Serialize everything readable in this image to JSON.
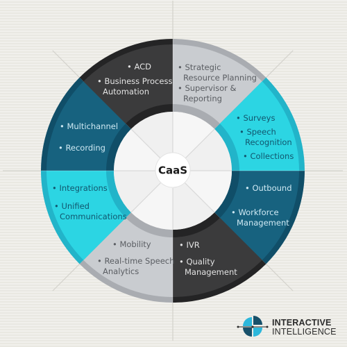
{
  "diagram": {
    "center_label": "CaaS",
    "colors": {
      "light_gray": "#c9ccd0",
      "light_gray_edge": "#a9acb1",
      "cyan": "#2cd5e3",
      "cyan_edge": "#22b4c9",
      "teal": "#17627f",
      "teal_edge": "#104e68",
      "charcoal": "#3b3b3c",
      "charcoal_edge": "#242425",
      "hub": "#f6f6f6"
    },
    "segments": [
      {
        "id": "strategic",
        "color": "light_gray",
        "text_color": "#5a5d62",
        "items": [
          "Strategic Resource Planning",
          "Supervisor & Reporting"
        ]
      },
      {
        "id": "surveys",
        "color": "cyan",
        "text_color": "#11566e",
        "items": [
          "Surveys",
          "Speech Recognition",
          "Collections"
        ]
      },
      {
        "id": "outbound",
        "color": "teal",
        "text_color": "#cfe9f3",
        "items": [
          "Outbound",
          "Workforce Management"
        ]
      },
      {
        "id": "ivr",
        "color": "charcoal",
        "text_color": "#e4e4e4",
        "items": [
          "IVR",
          "Quality Management"
        ]
      },
      {
        "id": "mobility",
        "color": "light_gray",
        "text_color": "#5a5d62",
        "items": [
          "Mobility",
          "Real-time Speech Analytics"
        ]
      },
      {
        "id": "integrations",
        "color": "cyan",
        "text_color": "#11566e",
        "items": [
          "Integrations",
          "Unified Communications"
        ]
      },
      {
        "id": "multichannel",
        "color": "teal",
        "text_color": "#cfe9f3",
        "items": [
          "Multichannel",
          "Recording"
        ]
      },
      {
        "id": "acd",
        "color": "charcoal",
        "text_color": "#e4e4e4",
        "items": [
          "ACD",
          "Business Process Automation"
        ]
      }
    ]
  },
  "logo": {
    "line1": "INTERACTIVE",
    "line2": "INTELLIGENCE",
    "colors": {
      "dark": "#17506a",
      "light": "#2cb7db"
    }
  }
}
